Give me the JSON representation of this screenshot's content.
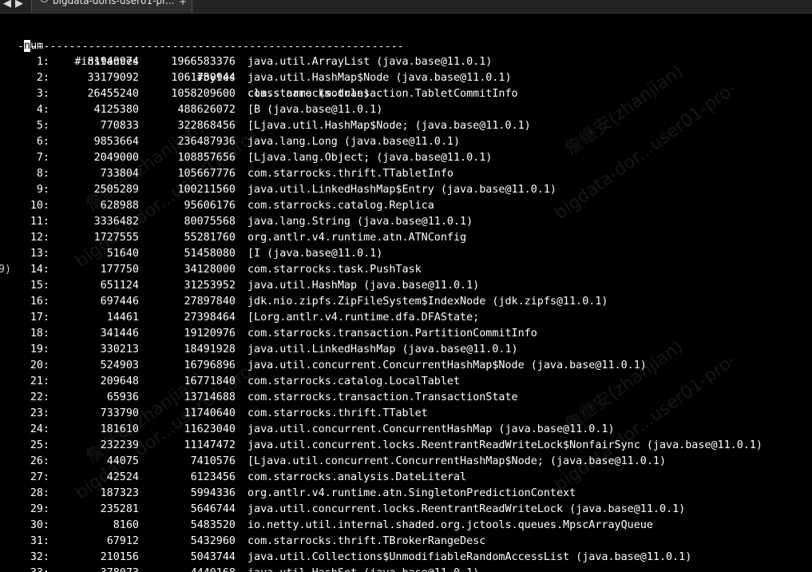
{
  "tab": {
    "back": "◀",
    "forward": "▶",
    "title": "bigdata-doris-user01-pr...",
    "close": "+"
  },
  "header": {
    "num_cursor": "n",
    "num_rest": "um",
    "instances": "#instances",
    "bytes": "#bytes",
    "class": "class name (module)"
  },
  "separator": "------------------------------------------------------------",
  "edge_fragment": "9)",
  "rows": [
    {
      "num": "1:",
      "instances": "81940974",
      "bytes": "1966583376",
      "class": "java.util.ArrayList (java.base@11.0.1)"
    },
    {
      "num": "2:",
      "instances": "33179092",
      "bytes": "1061730944",
      "class": "java.util.HashMap$Node (java.base@11.0.1)"
    },
    {
      "num": "3:",
      "instances": "26455240",
      "bytes": "1058209600",
      "class": "com.starrocks.transaction.TabletCommitInfo"
    },
    {
      "num": "4:",
      "instances": "4125380",
      "bytes": "488626072",
      "class": "[B (java.base@11.0.1)"
    },
    {
      "num": "5:",
      "instances": "770833",
      "bytes": "322868456",
      "class": "[Ljava.util.HashMap$Node; (java.base@11.0.1)"
    },
    {
      "num": "6:",
      "instances": "9853664",
      "bytes": "236487936",
      "class": "java.lang.Long (java.base@11.0.1)"
    },
    {
      "num": "7:",
      "instances": "2049000",
      "bytes": "108857656",
      "class": "[Ljava.lang.Object; (java.base@11.0.1)"
    },
    {
      "num": "8:",
      "instances": "733804",
      "bytes": "105667776",
      "class": "com.starrocks.thrift.TTabletInfo"
    },
    {
      "num": "9:",
      "instances": "2505289",
      "bytes": "100211560",
      "class": "java.util.LinkedHashMap$Entry (java.base@11.0.1)"
    },
    {
      "num": "10:",
      "instances": "628988",
      "bytes": "95606176",
      "class": "com.starrocks.catalog.Replica"
    },
    {
      "num": "11:",
      "instances": "3336482",
      "bytes": "80075568",
      "class": "java.lang.String (java.base@11.0.1)"
    },
    {
      "num": "12:",
      "instances": "1727555",
      "bytes": "55281760",
      "class": "org.antlr.v4.runtime.atn.ATNConfig"
    },
    {
      "num": "13:",
      "instances": "51640",
      "bytes": "51458080",
      "class": "[I (java.base@11.0.1)"
    },
    {
      "num": "14:",
      "instances": "177750",
      "bytes": "34128000",
      "class": "com.starrocks.task.PushTask"
    },
    {
      "num": "15:",
      "instances": "651124",
      "bytes": "31253952",
      "class": "java.util.HashMap (java.base@11.0.1)"
    },
    {
      "num": "16:",
      "instances": "697446",
      "bytes": "27897840",
      "class": "jdk.nio.zipfs.ZipFileSystem$IndexNode (jdk.zipfs@11.0.1)"
    },
    {
      "num": "17:",
      "instances": "14461",
      "bytes": "27398464",
      "class": "[Lorg.antlr.v4.runtime.dfa.DFAState;"
    },
    {
      "num": "18:",
      "instances": "341446",
      "bytes": "19120976",
      "class": "com.starrocks.transaction.PartitionCommitInfo"
    },
    {
      "num": "19:",
      "instances": "330213",
      "bytes": "18491928",
      "class": "java.util.LinkedHashMap (java.base@11.0.1)"
    },
    {
      "num": "20:",
      "instances": "524903",
      "bytes": "16796896",
      "class": "java.util.concurrent.ConcurrentHashMap$Node (java.base@11.0.1)"
    },
    {
      "num": "21:",
      "instances": "209648",
      "bytes": "16771840",
      "class": "com.starrocks.catalog.LocalTablet"
    },
    {
      "num": "22:",
      "instances": "65936",
      "bytes": "13714688",
      "class": "com.starrocks.transaction.TransactionState"
    },
    {
      "num": "23:",
      "instances": "733790",
      "bytes": "11740640",
      "class": "com.starrocks.thrift.TTablet"
    },
    {
      "num": "24:",
      "instances": "181610",
      "bytes": "11623040",
      "class": "java.util.concurrent.ConcurrentHashMap (java.base@11.0.1)"
    },
    {
      "num": "25:",
      "instances": "232239",
      "bytes": "11147472",
      "class": "java.util.concurrent.locks.ReentrantReadWriteLock$NonfairSync (java.base@11.0.1)"
    },
    {
      "num": "26:",
      "instances": "44075",
      "bytes": "7410576",
      "class": "[Ljava.util.concurrent.ConcurrentHashMap$Node; (java.base@11.0.1)"
    },
    {
      "num": "27:",
      "instances": "42524",
      "bytes": "6123456",
      "class": "com.starrocks.analysis.DateLiteral"
    },
    {
      "num": "28:",
      "instances": "187323",
      "bytes": "5994336",
      "class": "org.antlr.v4.runtime.atn.SingletonPredictionContext"
    },
    {
      "num": "29:",
      "instances": "235281",
      "bytes": "5646744",
      "class": "java.util.concurrent.locks.ReentrantReadWriteLock (java.base@11.0.1)"
    },
    {
      "num": "30:",
      "instances": "8160",
      "bytes": "5483520",
      "class": "io.netty.util.internal.shaded.org.jctools.queues.MpscArrayQueue"
    },
    {
      "num": "31:",
      "instances": "67912",
      "bytes": "5432960",
      "class": "com.starrocks.thrift.TBrokerRangeDesc"
    },
    {
      "num": "32:",
      "instances": "210156",
      "bytes": "5043744",
      "class": "java.util.Collections$UnmodifiableRandomAccessList (java.base@11.0.1)"
    },
    {
      "num": "33:",
      "instances": "378073",
      "bytes": "4440168",
      "class": "java.util.HashSet (java.base@11.0.1)"
    }
  ],
  "watermarks": [
    "詹继安(zhanjian)",
    "bigdata-dor...user01-pro-"
  ]
}
